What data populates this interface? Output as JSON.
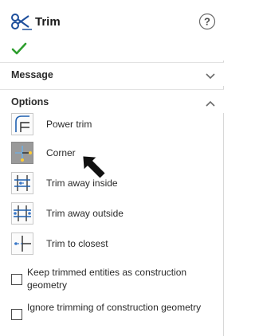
{
  "header": {
    "title": "Trim",
    "icons": {
      "tool": "trim-icon",
      "help": "help-icon",
      "ok": "checkmark-icon"
    }
  },
  "sections": {
    "message": {
      "title": "Message",
      "icon": "chevron-down-icon"
    },
    "options": {
      "title": "Options",
      "icon": "chevron-up-icon"
    }
  },
  "options": [
    {
      "label": "Power trim",
      "icon": "power-trim-icon",
      "selected": false
    },
    {
      "label": "Corner",
      "icon": "corner-icon",
      "selected": true
    },
    {
      "label": "Trim away inside",
      "icon": "trim-away-inside-icon",
      "selected": false
    },
    {
      "label": "Trim away outside",
      "icon": "trim-away-outside-icon",
      "selected": false
    },
    {
      "label": "Trim to closest",
      "icon": "trim-to-closest-icon",
      "selected": false
    }
  ],
  "checkboxes": [
    {
      "label": "Keep trimmed entities as construction geometry",
      "checked": false
    },
    {
      "label": "Ignore trimming of construction geometry",
      "checked": false
    }
  ],
  "colors": {
    "ok_green": "#2e9e2e",
    "help_blue": "#4a6ea8",
    "selected_bg": "#9a9a9a",
    "icon_blue": "#3a78c8"
  },
  "cursor": {
    "icon": "pointer-arrow-icon"
  }
}
